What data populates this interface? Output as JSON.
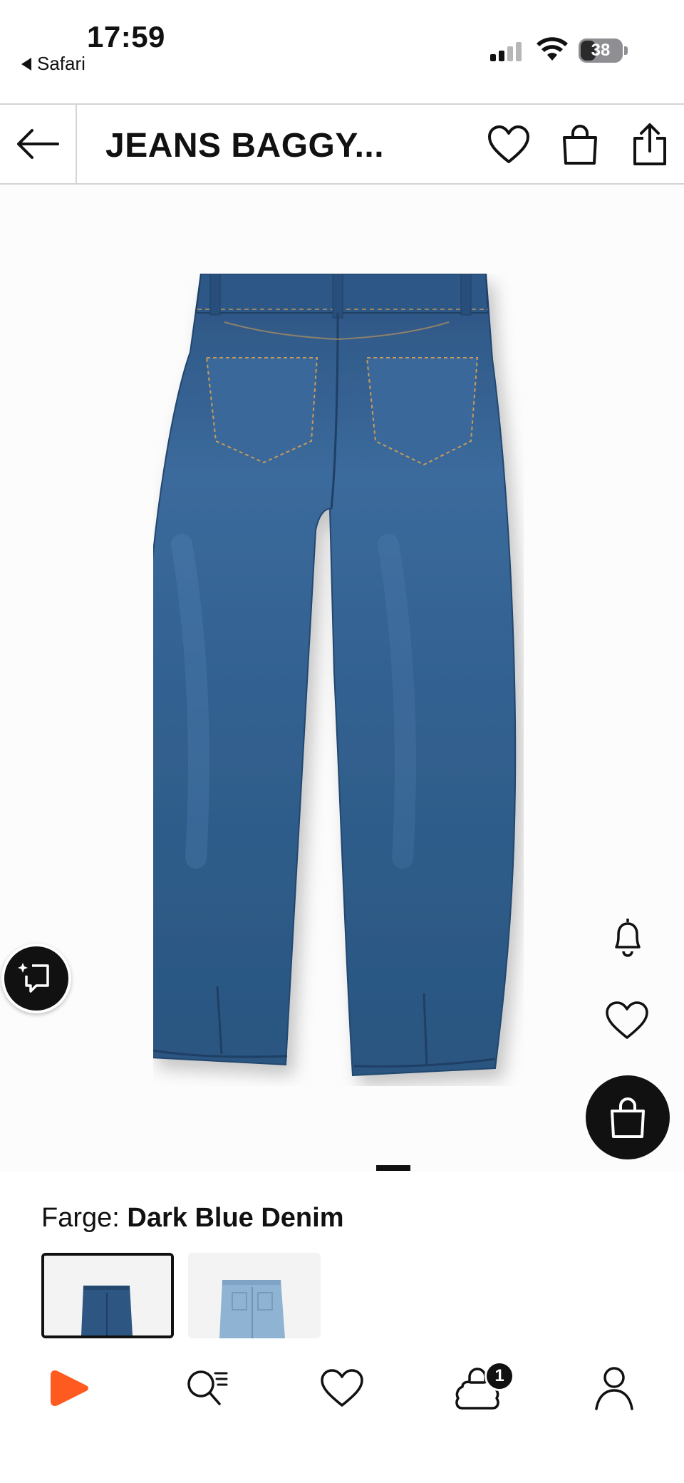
{
  "status_bar": {
    "time": "17:59",
    "back_app": "Safari",
    "battery": "38",
    "battery_level": 0.38
  },
  "header": {
    "title": "JEANS BAGGY..."
  },
  "gallery": {
    "image_name": "jeans-back-view",
    "page_index": 1
  },
  "product": {
    "color_label": "Farge:",
    "color_value": "Dark Blue Denim",
    "swatches": [
      "Dark Blue Denim",
      "Light Blue Denim"
    ]
  },
  "bottom_nav": {
    "items": [
      "home",
      "search",
      "wishlist",
      "bag",
      "account"
    ],
    "bag_count": "1"
  },
  "colors": {
    "brand": "#ff5a1f",
    "denim_dark": "#2e5682",
    "denim_light": "#8fb3d3"
  }
}
